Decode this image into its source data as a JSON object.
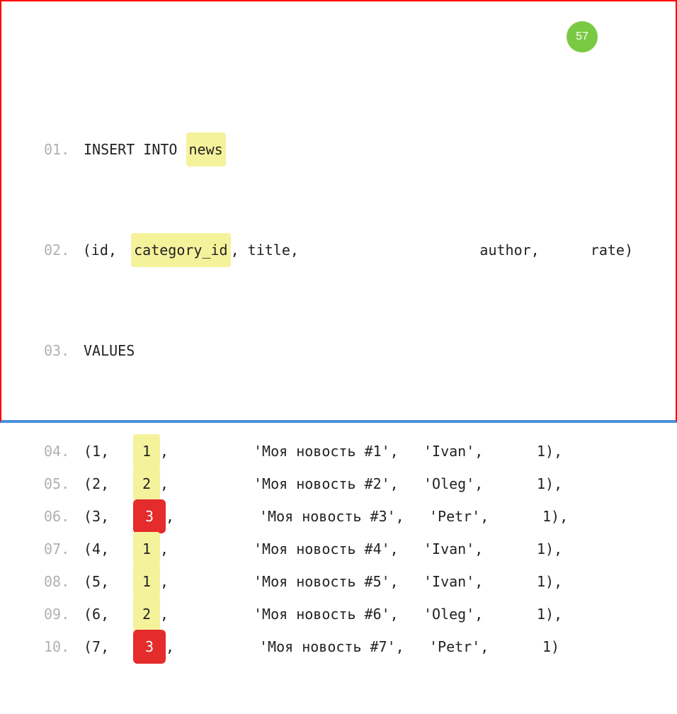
{
  "slide_number": "57",
  "line01": {
    "no": "01.",
    "insert": "INSERT INTO ",
    "table": "news"
  },
  "line02": {
    "no": "02.",
    "open": "(id, ",
    "hl": "category_id",
    "rest1": ", title,",
    "author": "author,",
    "rate": "rate)"
  },
  "line03": {
    "no": "03.",
    "text": "VALUES"
  },
  "rows": [
    {
      "no": "04.",
      "id_open": "(1,",
      "cat": "1",
      "cat_style": "yellow",
      "title": "'Моя новость #1',",
      "author": "'Ivan',",
      "rate": "1),"
    },
    {
      "no": "05.",
      "id_open": "(2,",
      "cat": "2",
      "cat_style": "yellow",
      "title": "'Моя новость #2',",
      "author": "'Oleg',",
      "rate": "1),"
    },
    {
      "no": "06.",
      "id_open": "(3,",
      "cat": "3",
      "cat_style": "red",
      "title": "'Моя новость #3',",
      "author": "'Petr',",
      "rate": "1),"
    },
    {
      "no": "07.",
      "id_open": "(4,",
      "cat": "1",
      "cat_style": "yellow",
      "title": "'Моя новость #4',",
      "author": "'Ivan',",
      "rate": "1),"
    },
    {
      "no": "08.",
      "id_open": "(5,",
      "cat": "1",
      "cat_style": "yellow",
      "title": "'Моя новость #5',",
      "author": "'Ivan',",
      "rate": "1),"
    },
    {
      "no": "09.",
      "id_open": "(6,",
      "cat": "2",
      "cat_style": "yellow",
      "title": "'Моя новость #6',",
      "author": "'Oleg',",
      "rate": "1),"
    },
    {
      "no": "10.",
      "id_open": "(7,",
      "cat": "3",
      "cat_style": "red",
      "title": "'Моя новость #7',",
      "author": "'Petr',",
      "rate": "1)"
    }
  ]
}
